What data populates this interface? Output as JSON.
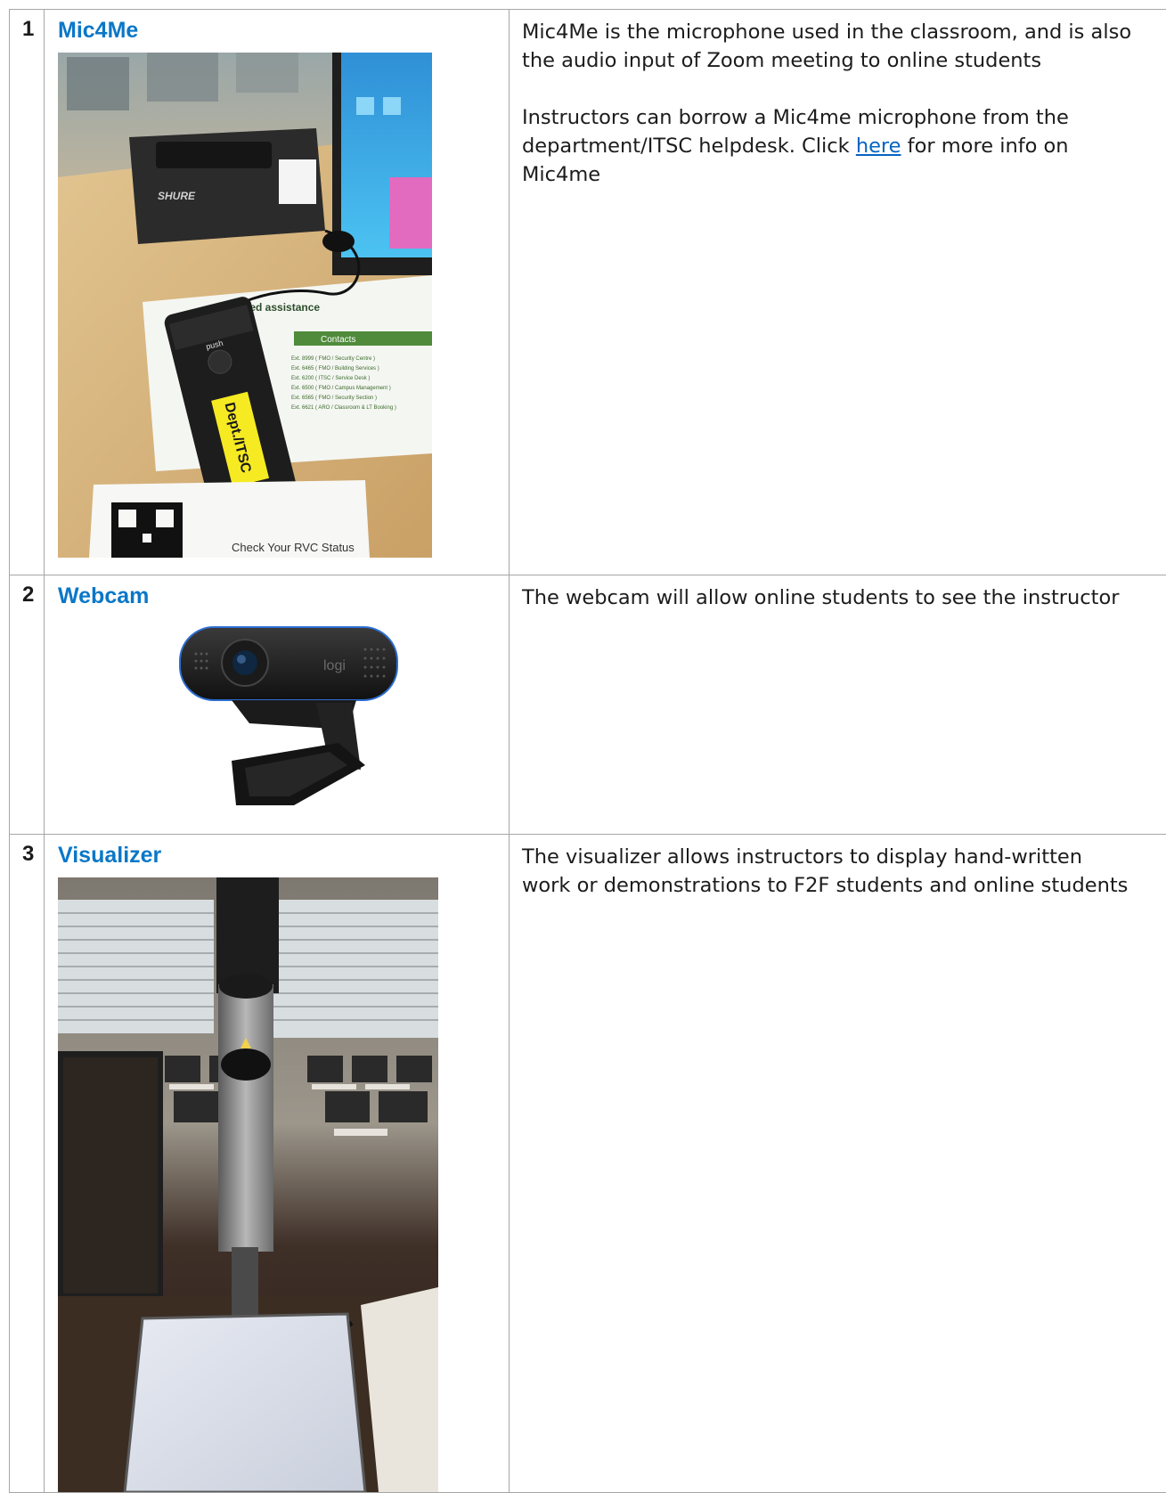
{
  "rows": [
    {
      "number": "1",
      "title": "Mic4Me",
      "paragraphs": [
        "Mic4Me is the microphone used in the classroom, and is also the audio input of Zoom meeting to online students",
        ""
      ],
      "p2_before": "Instructors can borrow a Mic4me microphone from the department/ITSC helpdesk. Click ",
      "p2_link": "here",
      "p2_after": " for more info on Mic4me",
      "photo_text": {
        "charger_brand": "SHURE",
        "sign_title": "Need assistance",
        "contacts_header": "Contacts",
        "contacts": [
          "Ext. 8999 ( FMO / Security Centre )",
          "Ext. 6465 ( FMO / Building Services )",
          "Ext. 6200 ( ITSC / Service Desk )",
          "Ext. 6500 ( FMO / Campus Management )",
          "Ext. 6565 ( FMO / Security Section )",
          "Ext. 6621 ( ARO / Classroom & LT Booking )"
        ],
        "push_label": "push",
        "sticker": "Dept./ITSC",
        "qr_caption": "Check Your RVC Status"
      }
    },
    {
      "number": "2",
      "title": "Webcam",
      "description": "The webcam will allow online students to see the instructor",
      "photo_text": {
        "brand": "logi"
      }
    },
    {
      "number": "3",
      "title": "Visualizer",
      "description": "The visualizer allows instructors to display hand-written work or demonstrations to F2F students and online students"
    }
  ]
}
